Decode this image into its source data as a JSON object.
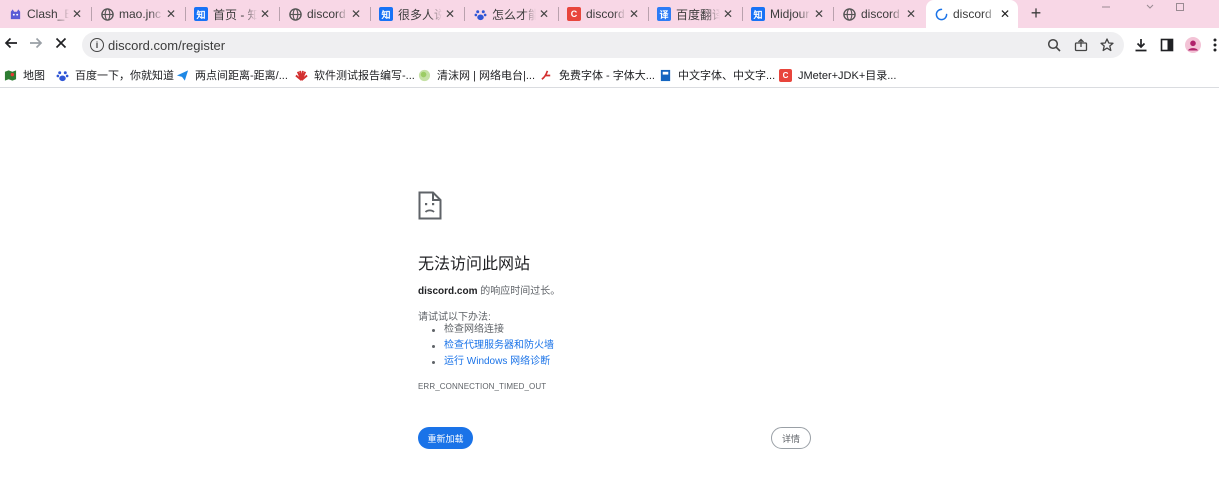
{
  "tabs": [
    {
      "title": "Clash_E",
      "favicon": "cat-icon",
      "color": "#5b5bd6"
    },
    {
      "title": "mao.jnc",
      "favicon": "globe-icon",
      "color": "#555555"
    },
    {
      "title": "首页 - 知",
      "favicon": "zhihu-icon",
      "color": "#1772f6"
    },
    {
      "title": "discord",
      "favicon": "globe-icon",
      "color": "#555555"
    },
    {
      "title": "很多人说",
      "favicon": "zhihu-icon",
      "color": "#1772f6"
    },
    {
      "title": "怎么才能",
      "favicon": "baidu-paw-icon",
      "color": "#2f56d6"
    },
    {
      "title": "discord",
      "favicon": "csdn-icon",
      "color": "#e8453c"
    },
    {
      "title": "百度翻译",
      "favicon": "fanyi-icon",
      "color": "#2d7cf6"
    },
    {
      "title": "Midjour",
      "favicon": "zhihu-icon",
      "color": "#1772f6"
    },
    {
      "title": "discord",
      "favicon": "globe-icon",
      "color": "#555555"
    },
    {
      "title": "discord",
      "favicon": "loading-spinner-icon",
      "color": "#1a73e8"
    }
  ],
  "favicon_glyphs": {
    "zhihu": "知",
    "csdn": "C",
    "fanyi": "译"
  },
  "address_bar": {
    "url": "discord.com/register"
  },
  "bookmarks": [
    {
      "label": "地图",
      "icon": "map-icon",
      "color": "#2e7d32"
    },
    {
      "label": "百度一下，你就知道",
      "icon": "baidu-paw-icon",
      "color": "#2f56d6"
    },
    {
      "label": "两点间距离-距离/...",
      "icon": "paper-plane-icon",
      "color": "#1e88e5"
    },
    {
      "label": "软件测试报告编写-...",
      "icon": "huawei-icon",
      "color": "#d32f2f"
    },
    {
      "label": "清沫网 | 网络电台|...",
      "icon": "ball-icon",
      "color": "#9ccc65"
    },
    {
      "label": "免费字体 - 字体大...",
      "icon": "font-icon",
      "color": "#d32f2f"
    },
    {
      "label": "中文字体、中文字...",
      "icon": "book-icon",
      "color": "#1565c0"
    },
    {
      "label": "JMeter+JDK+目录...",
      "icon": "csdn-icon",
      "color": "#e8453c"
    }
  ],
  "error": {
    "title": "无法访问此网站",
    "domain": "discord.com",
    "message": " 的响应时间过长。",
    "try_heading": "请试试以下办法:",
    "suggestions": [
      {
        "text": "检查网络连接",
        "link": false
      },
      {
        "text": "检查代理服务器和防火墙",
        "link": true
      },
      {
        "text": "运行 Windows 网络诊断",
        "link": true
      }
    ],
    "code": "ERR_CONNECTION_TIMED_OUT",
    "reload_label": "重新加载",
    "details_label": "详情"
  },
  "colors": {
    "accent": "#1a73e8",
    "tabstrip": "#f8d7e6"
  }
}
